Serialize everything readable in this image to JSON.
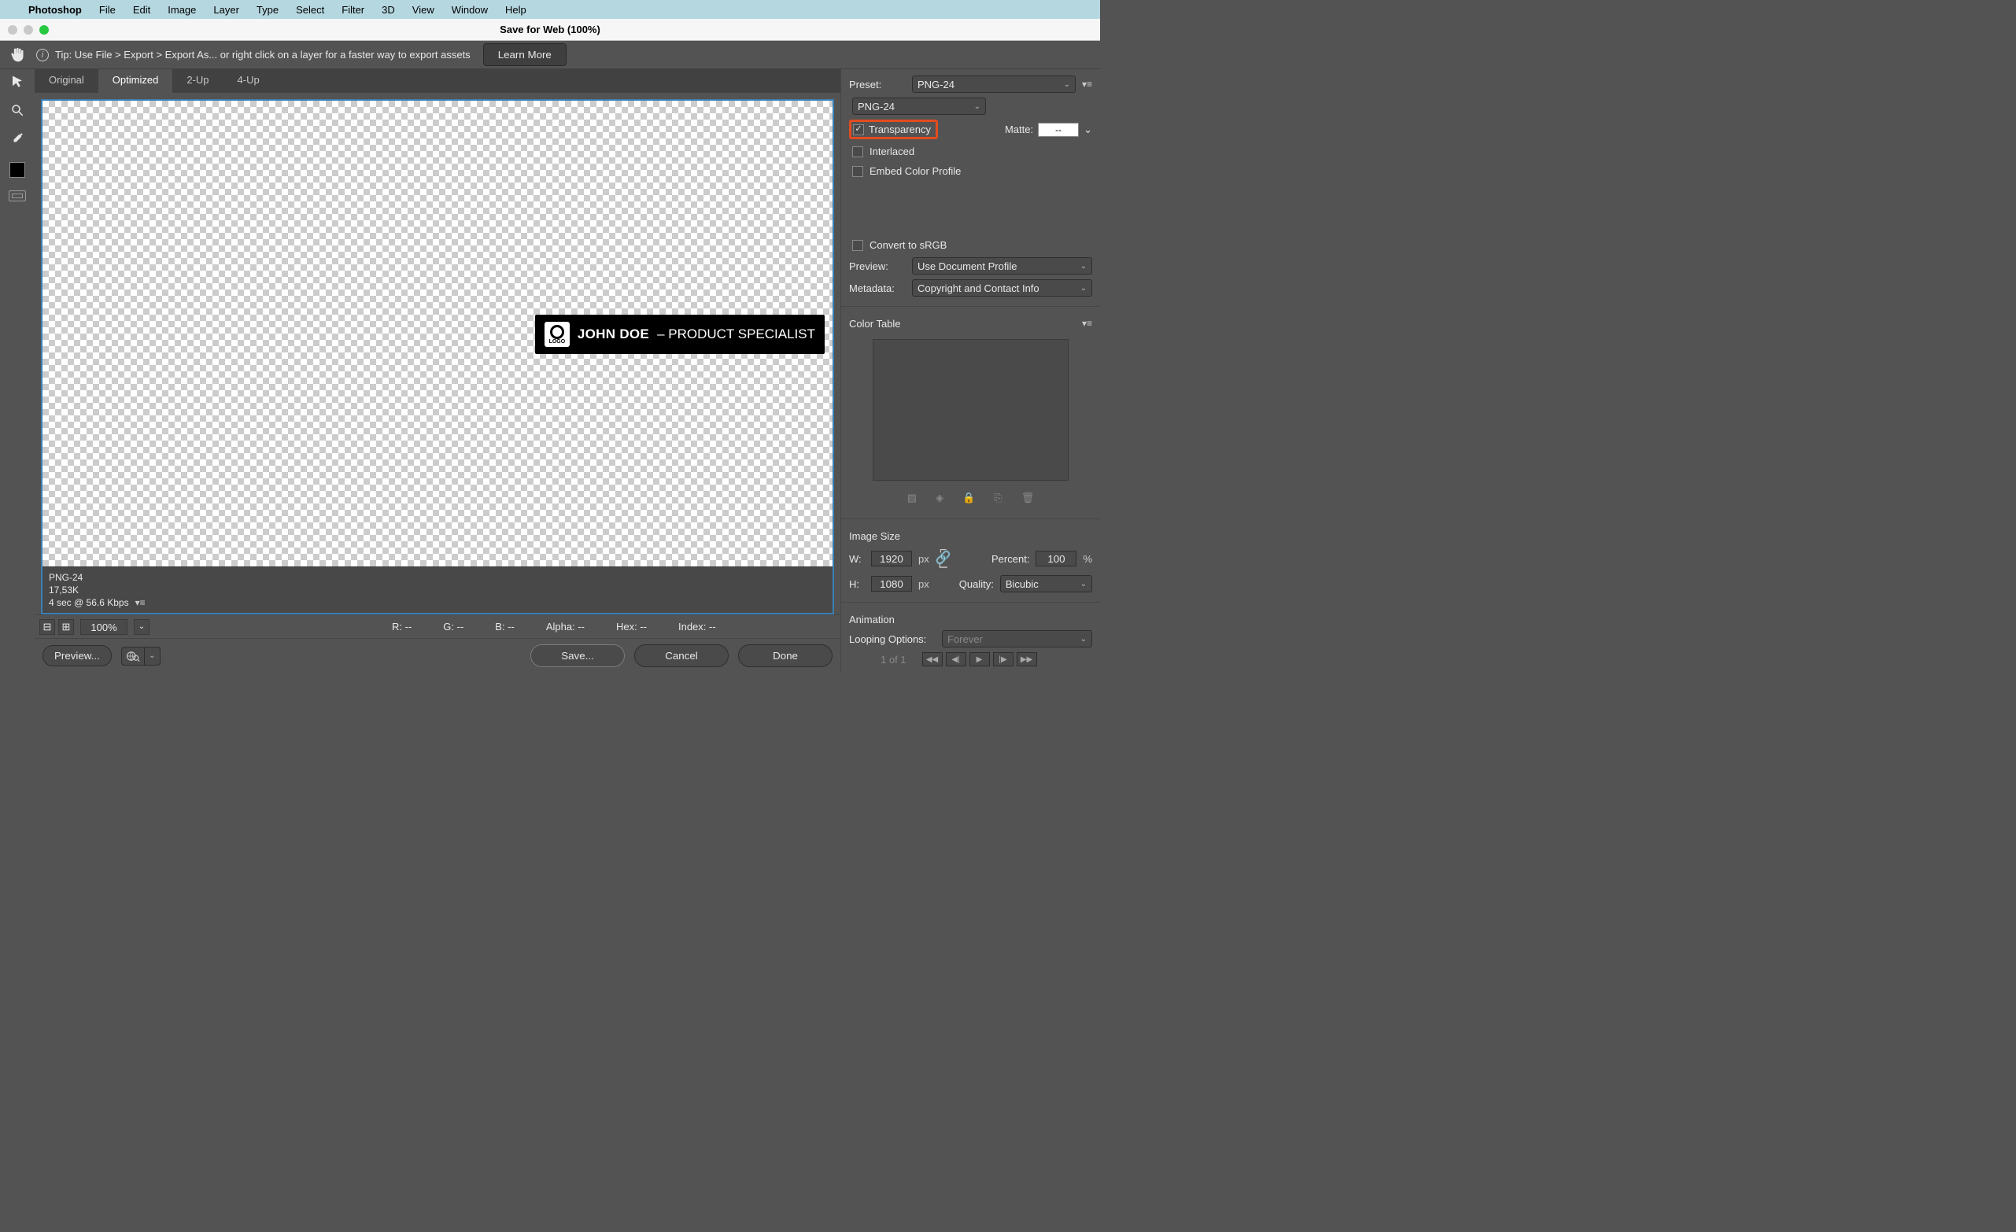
{
  "menubar": {
    "app": "Photoshop",
    "items": [
      "File",
      "Edit",
      "Image",
      "Layer",
      "Type",
      "Select",
      "Filter",
      "3D",
      "View",
      "Window",
      "Help"
    ]
  },
  "window": {
    "title": "Save for Web (100%)"
  },
  "tipbar": {
    "text": "Tip: Use File > Export > Export As...   or right click on a layer for a faster way to export assets",
    "learn_more": "Learn More"
  },
  "tabs": {
    "items": [
      "Original",
      "Optimized",
      "2-Up",
      "4-Up"
    ],
    "active": "Optimized"
  },
  "graphic": {
    "logo_text": "LOGO",
    "name": "JOHN DOE",
    "separator": " – ",
    "role": "PRODUCT SPECIALIST"
  },
  "canvas_info": {
    "format": "PNG-24",
    "size": "17,53K",
    "timing": "4 sec @ 56.6 Kbps"
  },
  "statusbar": {
    "zoom": "100%",
    "r": "R: --",
    "g": "G: --",
    "b": "B: --",
    "alpha": "Alpha: --",
    "hex": "Hex: --",
    "index": "Index: --"
  },
  "bottom": {
    "preview": "Preview...",
    "save": "Save...",
    "cancel": "Cancel",
    "done": "Done"
  },
  "panel": {
    "preset_lbl": "Preset:",
    "preset_val": "PNG-24",
    "format_val": "PNG-24",
    "transparency": "Transparency",
    "matte_lbl": "Matte:",
    "matte_val": "--",
    "interlaced": "Interlaced",
    "embed": "Embed Color Profile",
    "convert_srgb": "Convert to sRGB",
    "preview_lbl": "Preview:",
    "preview_val": "Use Document Profile",
    "metadata_lbl": "Metadata:",
    "metadata_val": "Copyright and Contact Info",
    "color_table": "Color Table",
    "image_size": "Image Size",
    "w_lbl": "W:",
    "w_val": "1920",
    "h_lbl": "H:",
    "h_val": "1080",
    "px": "px",
    "percent_lbl": "Percent:",
    "percent_val": "100",
    "percent_unit": "%",
    "quality_lbl": "Quality:",
    "quality_val": "Bicubic",
    "animation": "Animation",
    "loop_lbl": "Looping Options:",
    "loop_val": "Forever",
    "frame": "1 of 1"
  }
}
